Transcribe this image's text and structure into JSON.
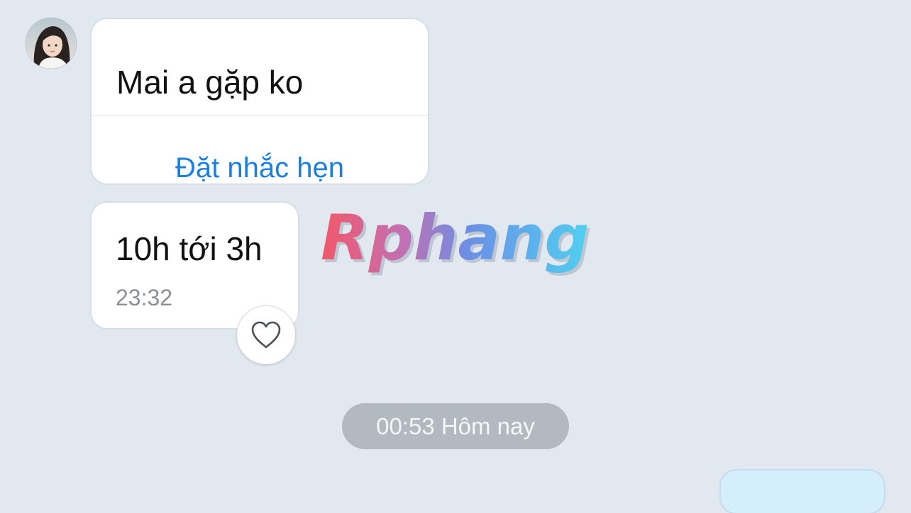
{
  "conversation": {
    "messages": [
      {
        "text": "Mai a gặp ko",
        "action_label": "Đặt nhắc hẹn"
      },
      {
        "text": "10h tới 3h",
        "time": "23:32"
      }
    ],
    "date_separator": "00:53 Hôm nay"
  },
  "watermark": {
    "text": "Rphang"
  },
  "icons": {
    "avatar": "contact-avatar",
    "reaction": "heart-icon"
  },
  "colors": {
    "background": "#e2e8f0",
    "bubble": "#ffffff",
    "action": "#1a7fe0",
    "date_pill": "#b3b9c1",
    "outgoing_bubble": "#d5eefc"
  }
}
